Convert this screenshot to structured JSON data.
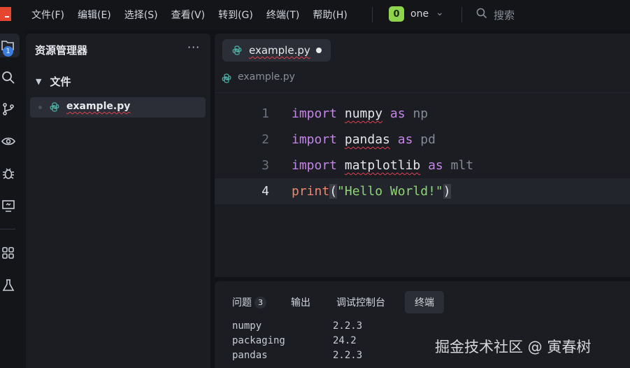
{
  "menubar": {
    "items": [
      "文件(F)",
      "编辑(E)",
      "选择(S)",
      "查看(V)",
      "转到(G)",
      "终端(T)",
      "帮助(H)"
    ],
    "workspace_badge": "0",
    "workspace_name": "one",
    "search_label": "搜索"
  },
  "activity_bar": {
    "explorer_badge": "1",
    "icons": [
      "explorer-icon",
      "search-icon",
      "source-control-icon",
      "preview-icon",
      "debug-icon",
      "remote-icon",
      "extensions-icon",
      "testing-icon"
    ]
  },
  "explorer": {
    "title": "资源管理器",
    "more": "···",
    "folder": "文件",
    "files": [
      {
        "name": "example.py"
      }
    ]
  },
  "editor": {
    "tab_name": "example.py",
    "breadcrumb": "example.py",
    "lines": [
      {
        "num": "1",
        "kw": "import",
        "mod": "numpy",
        "as": "as",
        "alias": "np"
      },
      {
        "num": "2",
        "kw": "import",
        "mod": "pandas",
        "as": "as",
        "alias": "pd"
      },
      {
        "num": "3",
        "kw": "import",
        "mod": "matplotlib",
        "as": "as",
        "alias": "mlt"
      },
      {
        "num": "4",
        "fn": "print",
        "open": "(",
        "str": "\"Hello World!\"",
        "close": ")"
      }
    ]
  },
  "panel": {
    "tabs": [
      "问题",
      "输出",
      "调试控制台",
      "终端"
    ],
    "problems_count": "3",
    "active_tab": "终端",
    "terminal_rows": [
      {
        "pkg": "numpy",
        "ver": "2.2.3"
      },
      {
        "pkg": "packaging",
        "ver": "24.2"
      },
      {
        "pkg": "pandas",
        "ver": "2.2.3"
      }
    ]
  },
  "watermark": "掘金技术社区 @ 寅春树",
  "colors": {
    "keyword": "#c586e8",
    "string": "#8fd478",
    "function": "#f0866e",
    "accent": "#3b7ddd",
    "workspace": "#8fd44d"
  }
}
